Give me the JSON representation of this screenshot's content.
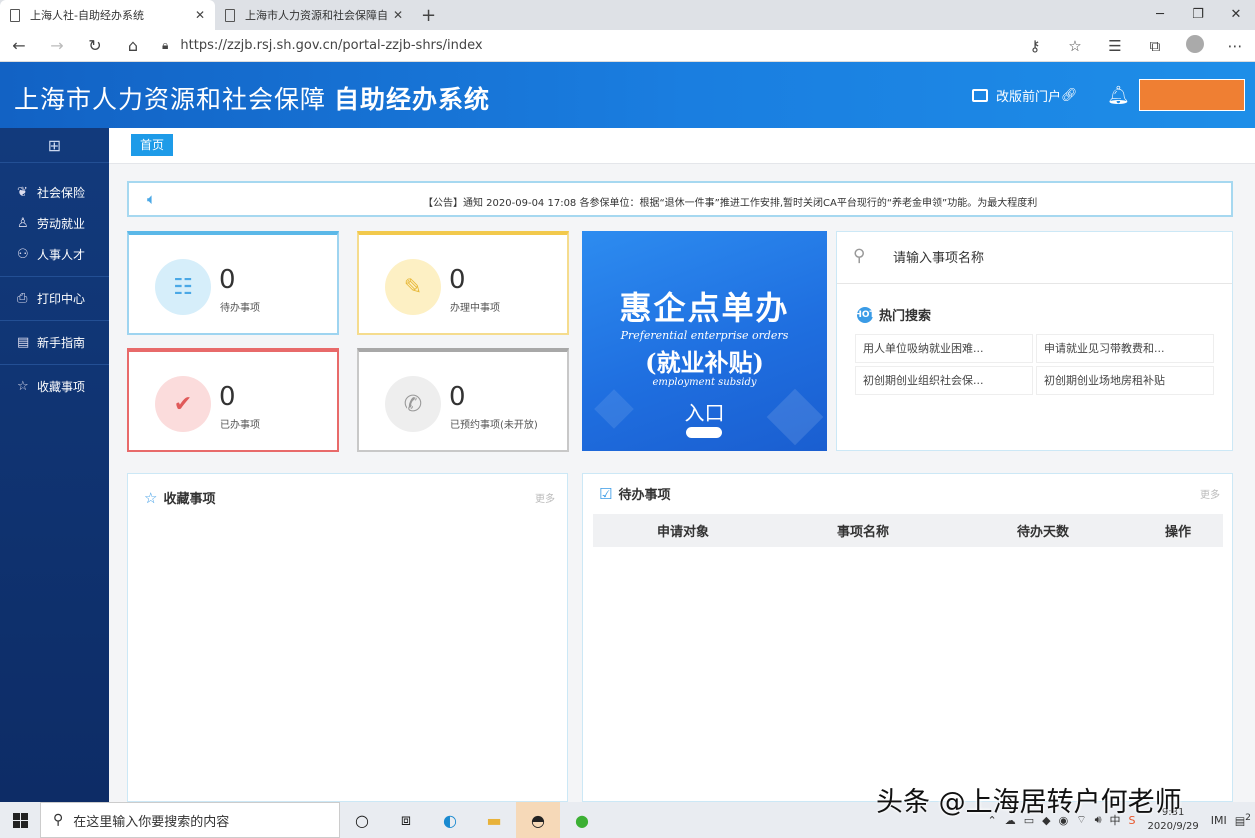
{
  "browser": {
    "tabs": [
      {
        "label": "上海人社-自助经办系统",
        "close": "✕"
      },
      {
        "label": "上海市人力资源和社会保障自助",
        "close": "✕"
      }
    ],
    "new_tab": "+",
    "url": "https://zzjb.rsj.sh.gov.cn/portal-zzjb-shrs/index"
  },
  "header": {
    "title_regular": "上海市人力资源和社会保障",
    "title_bold": "自助经办系统",
    "portal_link": "改版前门户",
    "user_box_color": "#ef7f33"
  },
  "sidebar": {
    "items": [
      {
        "label": "社会保险"
      },
      {
        "label": "劳动就业"
      },
      {
        "label": "人事人才"
      },
      {
        "label": "打印中心"
      },
      {
        "label": "新手指南"
      },
      {
        "label": "收藏事项"
      }
    ]
  },
  "breadcrumb": {
    "label": "首页"
  },
  "notice": {
    "text": "【公告】通知 2020-09-04 17:08 各参保单位：根据“退休一件事”推进工作安排,暂时关闭CA平台现行的“养老金申领”功能。为最大程度利"
  },
  "stats": [
    {
      "value": "0",
      "label": "待办事项",
      "color": "#5bb8e8"
    },
    {
      "value": "0",
      "label": "办理中事项",
      "color": "#f2c94c"
    },
    {
      "value": "0",
      "label": "已办事项",
      "color": "#e86a6a"
    },
    {
      "value": "0",
      "label": "已预约事项(未开放)",
      "color": "#a8a8a8"
    }
  ],
  "banner": {
    "title": "惠企点单办",
    "en1": "Preferential enterprise orders",
    "subtitle": "(就业补贴)",
    "en2": "employment subsidy",
    "entry": "入口"
  },
  "search": {
    "placeholder": "请输入事项名称",
    "hot_title": "热门搜索",
    "hot_badge": "HOT",
    "hot_items": [
      "用人单位吸纳就业困难...",
      "申请就业见习带教费和...",
      "初创期创业组织社会保...",
      "初创期创业场地房租补贴"
    ]
  },
  "favorites": {
    "title": "收藏事项",
    "more": "更多"
  },
  "pending": {
    "title": "待办事项",
    "more": "更多",
    "columns": [
      "申请对象",
      "事项名称",
      "待办天数",
      "操作"
    ]
  },
  "taskbar": {
    "search_placeholder": "在这里输入你要搜索的内容",
    "ime": "中",
    "time": "9:31",
    "date": "2020/9/29",
    "notify_count": "2"
  },
  "watermark": "头条 @上海居转户何老师"
}
